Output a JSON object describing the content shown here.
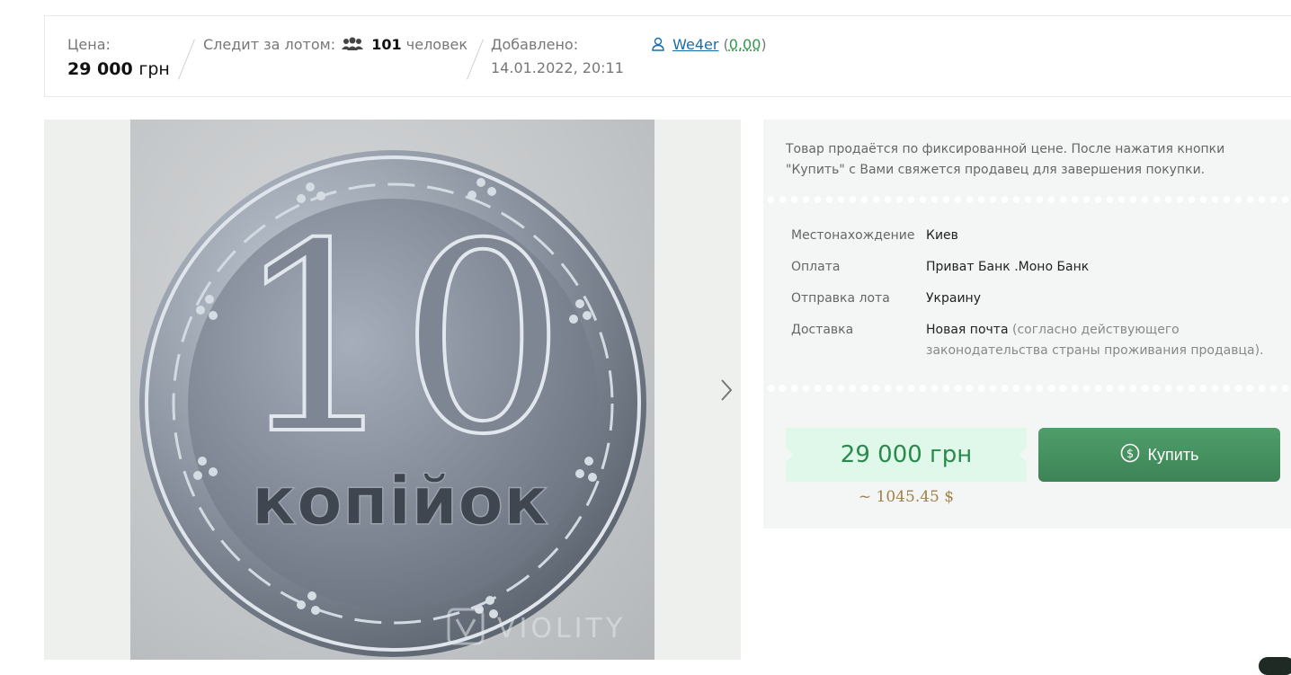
{
  "info_bar": {
    "price_label": "Цена:",
    "price_value": "29 000",
    "price_unit": "грн",
    "watchers_label": "Следит за лотом:",
    "watchers_count": "101",
    "watchers_unit": "человек",
    "added_label": "Добавлено:",
    "added_date": "14.01.2022, 20:11",
    "seller_name": "We4er",
    "seller_rating": "0.00",
    "icons": {
      "watchers": "people-icon",
      "seller": "user-icon"
    }
  },
  "gallery": {
    "photo": {
      "coin_number": "10",
      "coin_text": "копійок",
      "watermark": "VIOLITY"
    },
    "next_icon": "chevron-right-icon"
  },
  "panel": {
    "fixed_price_note": "Товар продаётся по фиксированной цене. После нажатия кнопки \"Купить\" с Вами свяжется продавец для завершения покупки.",
    "details": [
      {
        "key": "Местонахождение",
        "value": "Киев",
        "note": ""
      },
      {
        "key": "Оплата",
        "value": "Приват Банк .Моно Банк",
        "note": ""
      },
      {
        "key": "Отправка лота",
        "value": "Украину",
        "note": ""
      },
      {
        "key": "Доставка",
        "value": "Новая почта",
        "note": " (согласно действующего законодательства страны проживания продавца)."
      }
    ],
    "price": "29 000 грн",
    "price_usd": "~ 1045.45 $",
    "buy_label": "Купить",
    "buy_icon": "dollar-circle-icon"
  },
  "colors": {
    "accent_green": "#3d8456",
    "price_bg": "#e0f8ea",
    "price_text": "#2a8a4e",
    "link_blue": "#1a6dab",
    "usd_text": "#a0804a"
  }
}
